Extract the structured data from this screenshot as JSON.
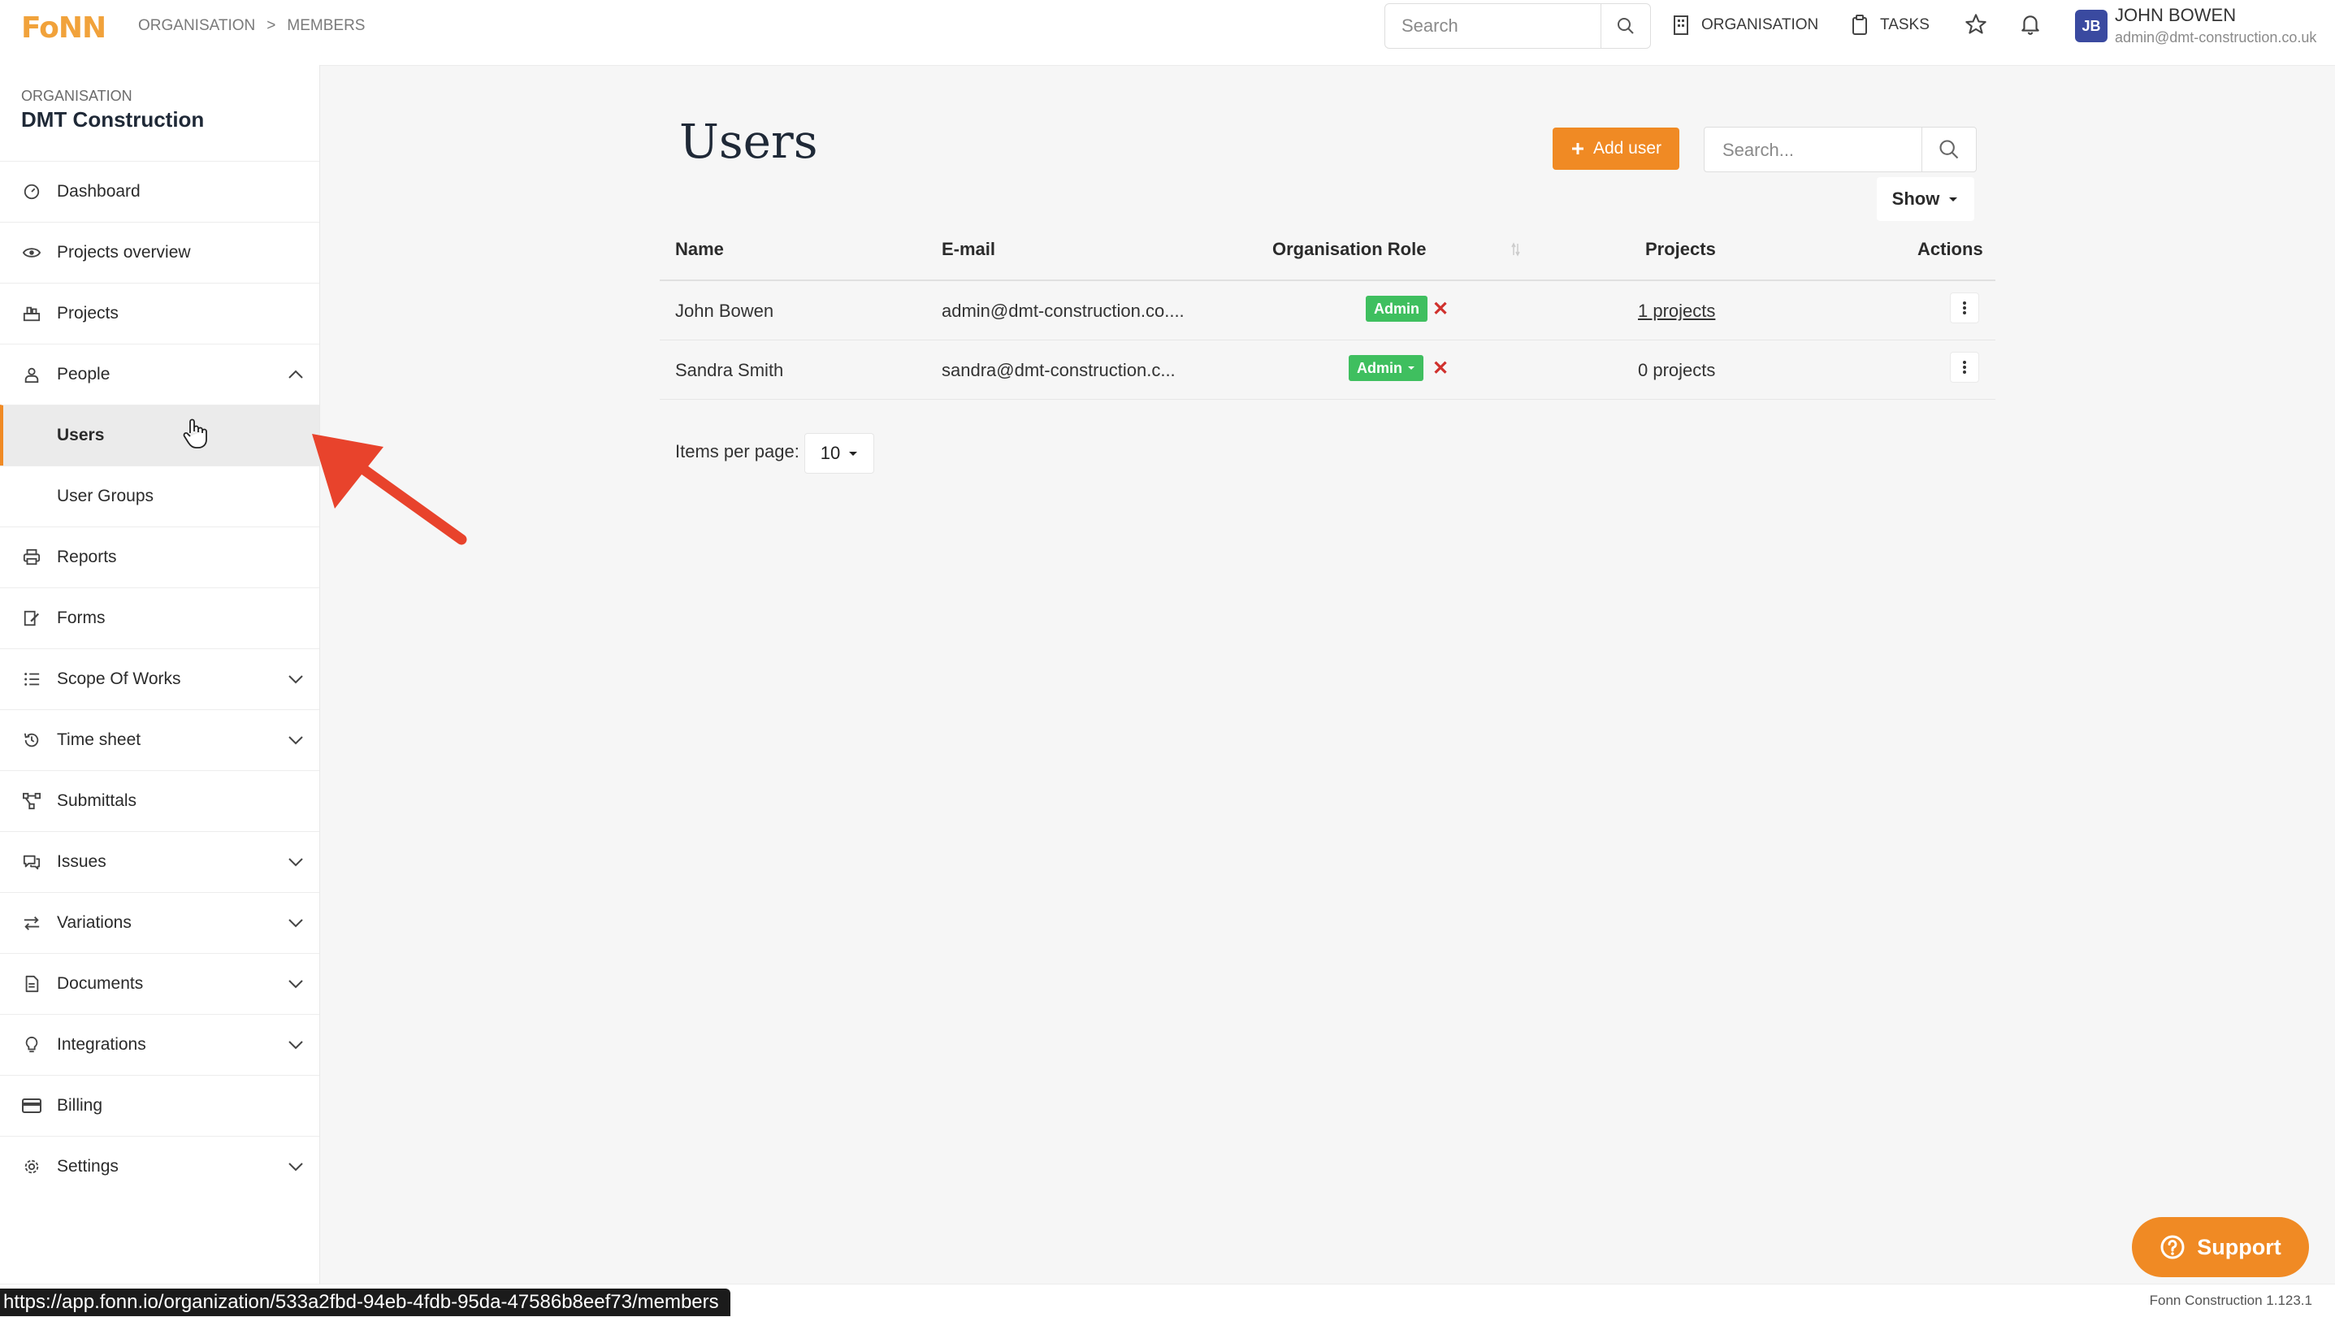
{
  "app": {
    "logo_text": "FoNN",
    "brand_color": "#f08a24",
    "breadcrumb": [
      "ORGANISATION",
      ">",
      "MEMBERS"
    ]
  },
  "topbar": {
    "search_placeholder": "Search",
    "organisation_label": "ORGANISATION",
    "tasks_label": "TASKS",
    "user_initials": "JB",
    "user_name": "JOHN BOWEN",
    "user_email": "admin@dmt-construction.co.uk"
  },
  "sidebar": {
    "org_label": "ORGANISATION",
    "org_name": "DMT Construction",
    "items": [
      {
        "label": "Dashboard",
        "icon": "dashboard-icon"
      },
      {
        "label": "Projects overview",
        "icon": "eye-icon"
      },
      {
        "label": "Projects",
        "icon": "projects-icon"
      },
      {
        "label": "People",
        "icon": "person-icon",
        "expanded": true
      },
      {
        "label": "Users",
        "active": true
      },
      {
        "label": "User Groups"
      },
      {
        "label": "Reports",
        "icon": "printer-icon"
      },
      {
        "label": "Forms",
        "icon": "form-edit-icon"
      },
      {
        "label": "Scope Of Works",
        "icon": "checklist-icon"
      },
      {
        "label": "Time sheet",
        "icon": "history-icon"
      },
      {
        "label": "Submittals",
        "icon": "workflow-icon"
      },
      {
        "label": "Issues",
        "icon": "chat-icon"
      },
      {
        "label": "Variations",
        "icon": "swap-icon"
      },
      {
        "label": "Documents",
        "icon": "document-icon"
      },
      {
        "label": "Integrations",
        "icon": "bulb-icon"
      },
      {
        "label": "Billing",
        "icon": "card-icon"
      },
      {
        "label": "Settings",
        "icon": "gear-icon"
      }
    ]
  },
  "main": {
    "title": "Users",
    "add_user_label": "Add user",
    "search_placeholder": "Search...",
    "show_label": "Show",
    "columns": [
      "Name",
      "E-mail",
      "Organisation Role",
      "Projects",
      "Actions"
    ],
    "rows": [
      {
        "name": "John Bowen",
        "email": "admin@dmt-construction.co....",
        "role": "Admin",
        "projects": "1 projects"
      },
      {
        "name": "Sandra Smith",
        "email": "sandra@dmt-construction.c...",
        "role": "Admin",
        "projects": "0 projects"
      }
    ],
    "items_per_page_label": "Items per page:",
    "items_per_page_value": "10"
  },
  "footer": {
    "support_label": "Support",
    "version": "Fonn Construction 1.123.1",
    "status_url": "https://app.fonn.io/organization/533a2fbd-94eb-4fdb-95da-47586b8eef73/members"
  },
  "colors": {
    "accent": "#f08a24",
    "role_badge": "#3fbf5f",
    "remove": "#d0312d",
    "annotation_arrow": "#e8432c"
  }
}
